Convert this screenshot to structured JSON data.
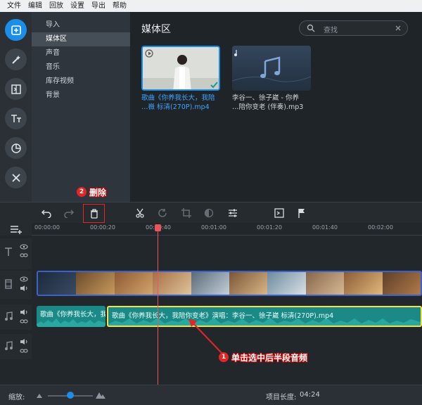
{
  "menu": [
    "文件",
    "编辑",
    "回放",
    "设置",
    "导出",
    "帮助"
  ],
  "categories": [
    "导入",
    "媒体区",
    "声音",
    "音乐",
    "库存视频",
    "背景"
  ],
  "media": {
    "title": "媒体区",
    "search_placeholder": "查找",
    "items": [
      {
        "caption_line1": "歌曲《你养我长大，我陪",
        "caption_line2": "…嶶 标清(270P).mp4",
        "selected": true
      },
      {
        "caption_line1": "李谷一、徐子崴 - 你养",
        "caption_line2": "…陪你变老 (伴奏).mp3",
        "selected": false
      }
    ]
  },
  "annotations": {
    "step1_number": "1",
    "step1_text": "单击选中后半段音频",
    "step2_number": "2",
    "step2_text": "删除"
  },
  "ruler_labels": [
    "00:00:00",
    "00:00:20",
    "00:00:40",
    "00:01:00",
    "00:01:20",
    "00:01:40",
    "00:02:00"
  ],
  "audio_clips": [
    {
      "label": "歌曲《你养我长大，我"
    },
    {
      "label": "歌曲《你养我长大，我陪你变老》演唱：李谷一、徐子崴 标清(270P).mp4"
    }
  ],
  "status": {
    "zoom_label": "缩放:",
    "zoom_level": 0.5,
    "project_length_label": "项目长度:",
    "project_length_value": "04:24"
  },
  "colors": {
    "accent": "#1b8ee8",
    "annotation_red": "#e52525",
    "audio_clip": "#1b8a86",
    "selected_outline": "#f2e24a",
    "playhead": "#e8555a"
  }
}
